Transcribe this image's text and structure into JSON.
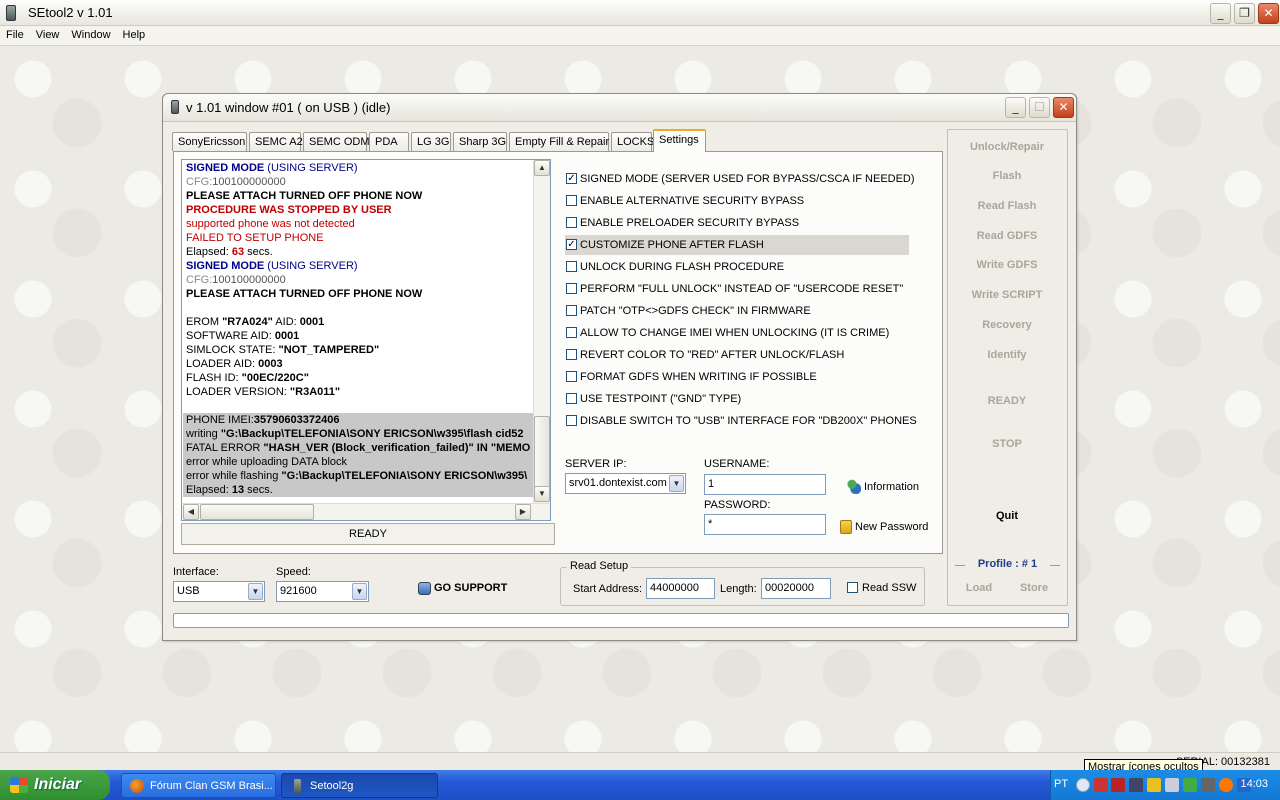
{
  "app": {
    "title": "SEtool2 v 1.01"
  },
  "menu": [
    "File",
    "View",
    "Window",
    "Help"
  ],
  "child": {
    "title": "v 1.01 window #01 ( on USB ) (idle)"
  },
  "tabs": [
    "SonyEricsson",
    "SEMC A2",
    "SEMC ODM",
    "PDA",
    "LG 3G",
    "Sharp 3G",
    "Empty Fill & Repair",
    "LOCKS",
    "Settings"
  ],
  "active_tab": "Settings",
  "log": {
    "l1a": "SIGNED MODE",
    "l1b": " (USING SERVER)",
    "l2a": "CFG:",
    "l2b": "100100000000",
    "l3": "PLEASE ATTACH TURNED OFF PHONE NOW",
    "l4": "PROCEDURE WAS STOPPED BY USER",
    "l5": "supported phone was not detected",
    "l6": "FAILED TO SETUP PHONE",
    "l7a": "Elapsed: ",
    "l7b": "63",
    "l7c": " secs.",
    "l8a": "SIGNED MODE",
    "l8b": " (USING SERVER)",
    "l9a": "CFG:",
    "l9b": "100100000000",
    "l10": "PLEASE ATTACH TURNED OFF PHONE NOW",
    "l12a": "EROM ",
    "l12b": "\"R7A024\"",
    "l12c": " AID: ",
    "l12d": "0001",
    "l13a": "SOFTWARE AID: ",
    "l13b": "0001",
    "l14a": "SIMLOCK STATE: ",
    "l14b": "\"NOT_TAMPERED\"",
    "l15a": "LOADER AID: ",
    "l15b": "0003",
    "l16a": "FLASH ID: ",
    "l16b": "\"00EC/220C\"",
    "l17a": "LOADER VERSION: ",
    "l17b": "\"R3A011\"",
    "l19a": "PHONE IMEI:",
    "l19b": "35790603372406",
    "l20a": "writing ",
    "l20b": "\"G:\\Backup\\TELEFONIA\\SONY ERICSON\\w395\\flash cid52",
    "l21a": "FATAL ERROR ",
    "l21b": "\"HASH_VER (Block_verification_failed)\" IN \"MEMO",
    "l22": "error while uploading DATA block",
    "l23a": "error while flashing ",
    "l23b": "\"G:\\Backup\\TELEFONIA\\SONY ERICSON\\w395\\",
    "l24a": "Elapsed: ",
    "l24b": "13",
    "l24c": " secs."
  },
  "ready_label": "READY",
  "options": [
    {
      "label": "SIGNED MODE (SERVER USED FOR BYPASS/CSCA IF NEEDED)",
      "checked": true
    },
    {
      "label": "ENABLE ALTERNATIVE SECURITY BYPASS",
      "checked": false
    },
    {
      "label": "ENABLE PRELOADER SECURITY BYPASS",
      "checked": false
    },
    {
      "label": "CUSTOMIZE PHONE AFTER FLASH",
      "checked": true
    },
    {
      "label": "UNLOCK DURING FLASH PROCEDURE",
      "checked": false
    },
    {
      "label": "PERFORM \"FULL UNLOCK\" INSTEAD OF \"USERCODE RESET\"",
      "checked": false
    },
    {
      "label": "PATCH \"OTP<>GDFS CHECK\" IN FIRMWARE",
      "checked": false
    },
    {
      "label": "ALLOW TO CHANGE IMEI WHEN UNLOCKING (IT IS CRIME)",
      "checked": false
    },
    {
      "label": "REVERT COLOR TO \"RED\" AFTER UNLOCK/FLASH",
      "checked": false
    },
    {
      "label": "FORMAT GDFS WHEN WRITING IF POSSIBLE",
      "checked": false
    },
    {
      "label": "USE TESTPOINT (\"GND\" TYPE)",
      "checked": false
    },
    {
      "label": "DISABLE SWITCH TO \"USB\" INTERFACE FOR \"DB200X\" PHONES",
      "checked": false
    }
  ],
  "server": {
    "ip_label": "SERVER IP:",
    "ip_value": "srv01.dontexist.com",
    "user_label": "USERNAME:",
    "user_value": "1",
    "pass_label": "PASSWORD:",
    "pass_value": "*",
    "info_label": "Information",
    "newpass_label": "New Password"
  },
  "right_buttons": {
    "unlock": "Unlock/Repair",
    "flash": "Flash",
    "read_flash": "Read Flash",
    "read_gdfs": "Read GDFS",
    "write_gdfs": "Write GDFS",
    "write_script": "Write SCRIPT",
    "recovery": "Recovery",
    "identify": "Identify",
    "ready": "READY",
    "stop": "STOP",
    "quit": "Quit",
    "profile": "Profile : # 1",
    "load": "Load",
    "store": "Store"
  },
  "bottom": {
    "interface_label": "Interface:",
    "interface_value": "USB",
    "speed_label": "Speed:",
    "speed_value": "921600",
    "support_label": "GO SUPPORT",
    "read_setup_label": "Read Setup",
    "start_label": "Start Address:",
    "start_value": "44000000",
    "length_label": "Length:",
    "length_value": "00020000",
    "readssw_label": "Read SSW"
  },
  "status": {
    "serial": "SERIAL: 00132381",
    "tooltip": "Mostrar ícones ocultos"
  },
  "taskbar": {
    "start": "Iniciar",
    "task1": "Fórum Clan GSM Brasi...",
    "task2": "Setool2g",
    "lang": "PT",
    "clock": "14:03"
  },
  "colors": {
    "accent_tab": "#f0a734",
    "log_blue": "#00008b",
    "log_red": "#c00000",
    "taskbar": "#2459d6"
  }
}
